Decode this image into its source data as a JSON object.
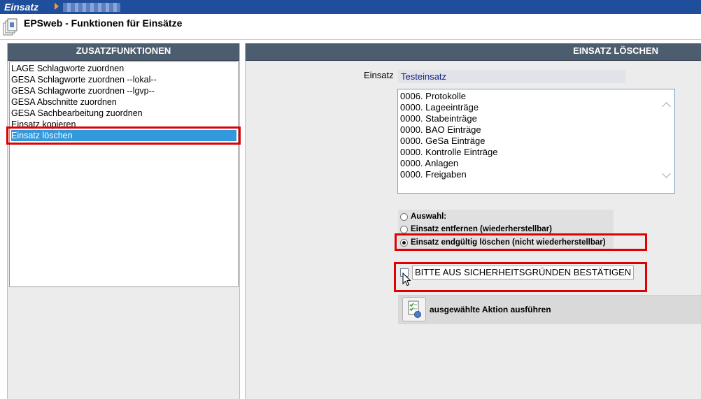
{
  "topbar": {
    "app_name": "Einsatz",
    "breadcrumb": "(blurred)"
  },
  "header": {
    "title": "EPSweb - Funktionen für Einsätze",
    "doc_icon": "document-stack-icon"
  },
  "left_panel": {
    "title": "ZUSATZFUNKTIONEN",
    "items": [
      {
        "label": "LAGE Schlagworte zuordnen"
      },
      {
        "label": "GESA Schlagworte zuordnen --lokal--"
      },
      {
        "label": "GESA Schlagworte zuordnen --lgvp--"
      },
      {
        "label": "GESA Abschnitte zuordnen"
      },
      {
        "label": "GESA Sachbearbeitung zuordnen"
      },
      {
        "label": "Einsatz kopieren"
      },
      {
        "label": "Einsatz löschen"
      }
    ],
    "selected_index": 6
  },
  "right_panel": {
    "title": "EINSATZ LÖSCHEN",
    "einsatz_label": "Einsatz",
    "einsatz_value": "Testeinsatz",
    "stats": [
      "0006. Protokolle",
      "0000. Lageeinträge",
      "0000. Stabeinträge",
      "0000. BAO Einträge",
      "0000. GeSa Einträge",
      "0000. Kontrolle Einträge",
      "0000. Anlagen",
      "0000. Freigaben"
    ],
    "radio": {
      "options": [
        {
          "label": "Auswahl:",
          "checked": false
        },
        {
          "label": "Einsatz entfernen (wiederherstellbar)",
          "checked": false
        },
        {
          "label": "Einsatz endgültig löschen (nicht wiederherstellbar)",
          "checked": true
        }
      ]
    },
    "confirm": {
      "label": "BITTE AUS SICHERHEITSGRÜNDEN BESTÄTIGEN",
      "checked": false
    },
    "action": {
      "label": "ausgewählte Aktion ausführen",
      "icon": "checklist-icon"
    }
  },
  "colors": {
    "topbar": "#1f4e9c",
    "panel_header": "#4d5d70",
    "selection": "#3399dd",
    "highlight_box": "#e00000"
  }
}
